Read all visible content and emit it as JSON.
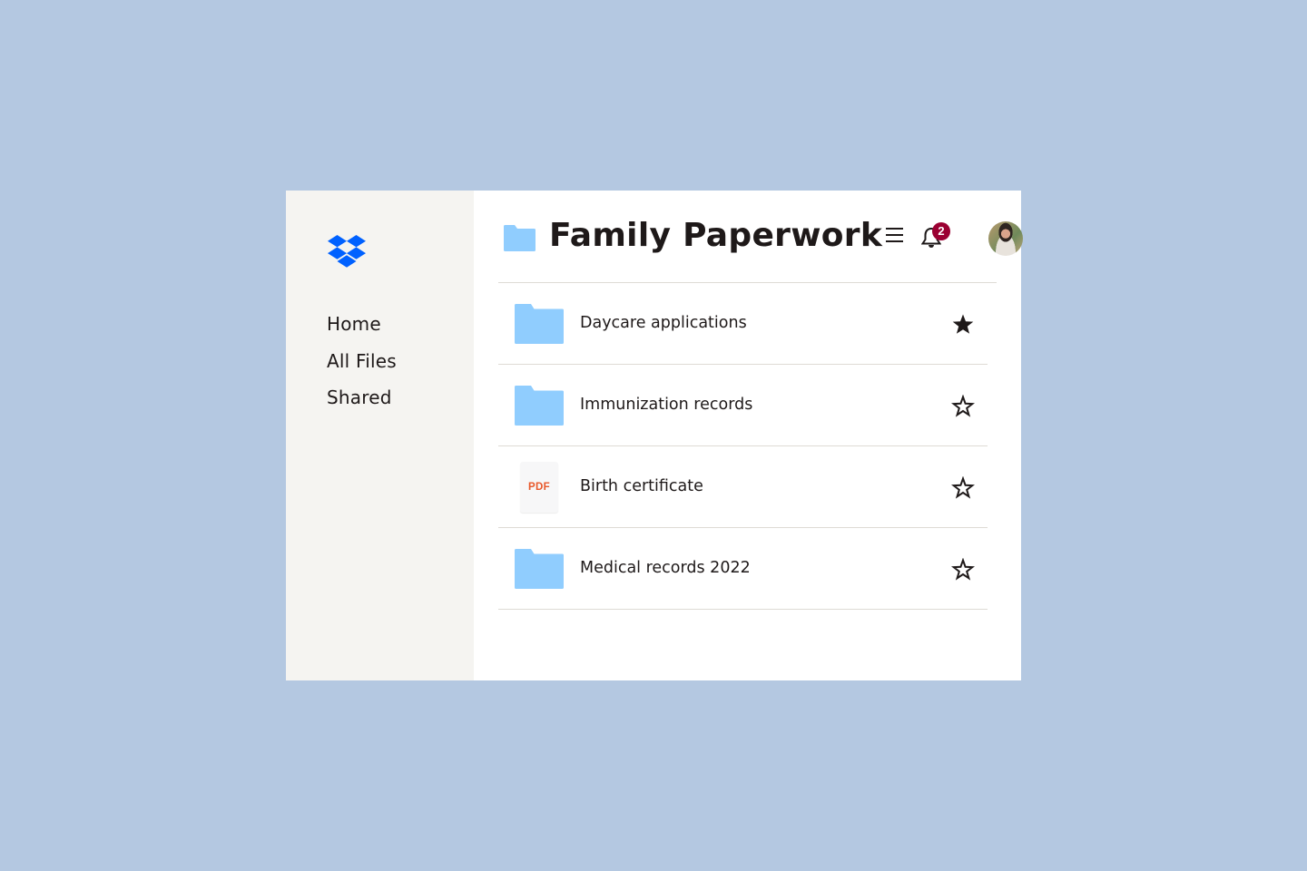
{
  "app": {
    "brand": "Dropbox",
    "brand_color": "#0061ff"
  },
  "sidebar": {
    "items": [
      {
        "label": "Home"
      },
      {
        "label": "All Files"
      },
      {
        "label": "Shared"
      }
    ]
  },
  "header": {
    "title": "Family Paperwork",
    "title_icon": "folder-icon",
    "menu_icon": "hamburger-menu-icon",
    "notification_icon": "bell-icon",
    "notification_count": "2",
    "avatar": "user-avatar"
  },
  "files": [
    {
      "name": "Daycare applications",
      "type": "folder",
      "starred": true
    },
    {
      "name": "Immunization records",
      "type": "folder",
      "starred": false
    },
    {
      "name": "Birth certificate",
      "type": "pdf",
      "type_label": "PDF",
      "starred": false
    },
    {
      "name": "Medical records 2022",
      "type": "folder",
      "starred": false
    }
  ],
  "colors": {
    "background": "#b4c8e1",
    "sidebar": "#f5f4f1",
    "folder": "#90cdfe",
    "badge": "#9b0032",
    "pdf_label": "#e8582b",
    "text": "#1e1919"
  }
}
